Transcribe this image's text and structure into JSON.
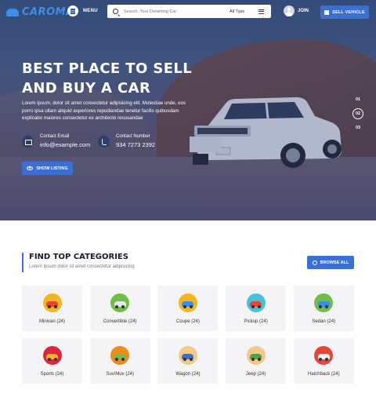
{
  "brand": {
    "name": "CAROMA"
  },
  "nav": {
    "menu_label": "MENU",
    "search_placeholder": "Search, Your Dreaming Car",
    "type_label": "All Type",
    "join_label": "JOIN",
    "sell_label": "SELL VEHICLE"
  },
  "hero": {
    "title_line1": "BEST PLACE TO SELL",
    "title_line2": "AND BUY A CAR",
    "description": "Lorem ipsum, dolor sit amet consectetur adipisicing elit. Molestiae unde, eos porro ipsa ullam aliquid asperiores repudiandae tenetur facilis quibusdam explicabo maiores consectetur ex architecto recusandae",
    "contact_email_label": "Contact Email",
    "contact_email": "info@example.com",
    "contact_number_label": "Contact Number",
    "contact_number": "934 7273 2392",
    "show_listing_label": "SHOW LISTING",
    "slides": [
      "01",
      "02",
      "03"
    ],
    "active_slide": 1
  },
  "categories": {
    "title": "FIND TOP CATEGORIES",
    "subtitle": "Lorem ipsum dolor sit amet consectetur adipisicing",
    "browse_label": "BROWSE ALL",
    "items": [
      {
        "name": "Minivan (24)",
        "icon": "minivan-icon",
        "circle": "#f6b41e",
        "car": "#e5463a"
      },
      {
        "name": "Convertible (24)",
        "icon": "convertible-icon",
        "circle": "#6fbf47",
        "car": "#e8e8e8"
      },
      {
        "name": "Coupe (24)",
        "icon": "coupe-icon",
        "circle": "#f6b41e",
        "car": "#3c8ee6"
      },
      {
        "name": "Pickup (24)",
        "icon": "pickup-icon",
        "circle": "#48c1d8",
        "car": "#e5463a"
      },
      {
        "name": "Sedan (24)",
        "icon": "sedan-icon",
        "circle": "#6fbf47",
        "car": "#3c8ee6"
      },
      {
        "name": "Sports (24)",
        "icon": "sports-car-icon",
        "circle": "#d9283a",
        "car": "#f6b41e"
      },
      {
        "name": "Suv/Muv (24)",
        "icon": "suv-icon",
        "circle": "#f08a1c",
        "car": "#6fbf47"
      },
      {
        "name": "Wagon (24)",
        "icon": "wagon-icon",
        "circle": "#f3c98a",
        "car": "#3b6fd4"
      },
      {
        "name": "Jeep (24)",
        "icon": "jeep-icon",
        "circle": "#f3c98a",
        "car": "#4aa44a"
      },
      {
        "name": "Hatchback (24)",
        "icon": "hatchback-icon",
        "circle": "#e5463a",
        "car": "#f4f4f6"
      }
    ]
  },
  "colors": {
    "accent": "#3b6fd4",
    "brand": "#3c8ee6"
  }
}
